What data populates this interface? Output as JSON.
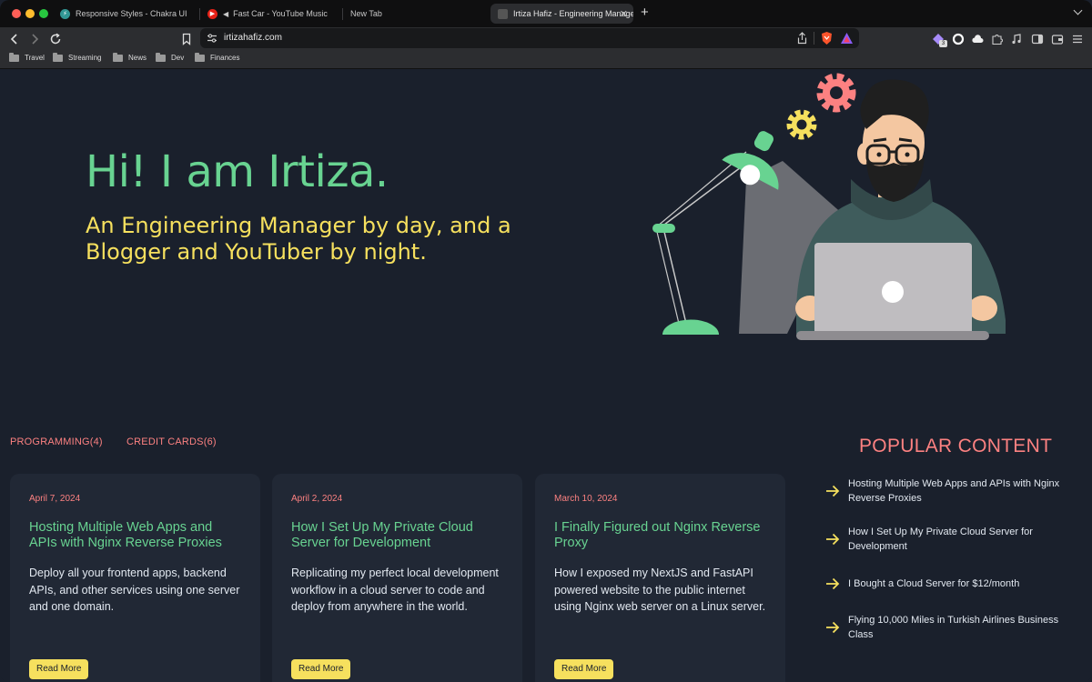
{
  "browser": {
    "tabs": [
      {
        "title": "Responsive Styles - Chakra UI",
        "active": false
      },
      {
        "title": "Fast Car - YouTube Music",
        "active": false
      },
      {
        "title": "New Tab",
        "active": false
      },
      {
        "title": "Irtiza Hafiz - Engineering Manager",
        "active": true
      }
    ],
    "url": "irtizahafiz.com",
    "bookmarks": [
      "Travel",
      "Streaming",
      "News",
      "Dev",
      "Finances"
    ],
    "extension_badge": "3"
  },
  "hero": {
    "title": "Hi! I am Irtiza.",
    "subtitle": "An Engineering Manager by day, and a Blogger and YouTuber by night."
  },
  "categories": [
    "PROGRAMMING(4)",
    "CREDIT CARDS(6)"
  ],
  "posts": [
    {
      "date": "April 7, 2024",
      "title": "Hosting Multiple Web Apps and APIs with Nginx Reverse Proxies",
      "description": "Deploy all your frontend apps, backend APIs, and other services using one server and one domain.",
      "button": "Read More"
    },
    {
      "date": "April 2, 2024",
      "title": "How I Set Up My Private Cloud Server for Development",
      "description": "Replicating my perfect local development workflow in a cloud server to code and deploy from anywhere in the world.",
      "button": "Read More"
    },
    {
      "date": "March 10, 2024",
      "title": "I Finally Figured out Nginx Reverse Proxy",
      "description": "How I exposed my NextJS and FastAPI powered website to the public internet using Nginx web server on a Linux server.",
      "button": "Read More"
    }
  ],
  "popular": {
    "title": "POPULAR CONTENT",
    "items": [
      "Hosting Multiple Web Apps and APIs with Nginx Reverse Proxies",
      "How I Set Up My Private Cloud Server for Development",
      "I Bought a Cloud Server for $12/month",
      "Flying 10,000 Miles in Turkish Airlines Business Class"
    ]
  },
  "colors": {
    "background": "#1a202c",
    "card": "#212835",
    "green": "#68d391",
    "yellow": "#f6e05e",
    "coral": "#fc8181"
  }
}
